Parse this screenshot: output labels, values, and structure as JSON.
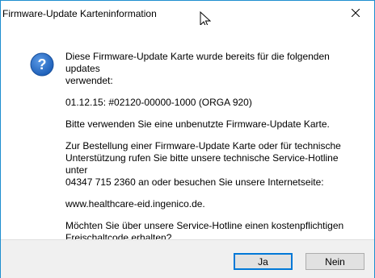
{
  "window": {
    "title": "Firmware-Update Karteninformation"
  },
  "icons": {
    "close": "close-icon",
    "question": "question-icon",
    "cursor": "mouse-cursor-icon"
  },
  "colors": {
    "window_border": "#1e8ecf",
    "icon_blue": "#1d5fb8",
    "footer_bg": "#f0f0f0",
    "button_bg": "#e1e1e1",
    "default_button_border": "#0078d7"
  },
  "message": {
    "paragraphs": [
      "Diese Firmware-Update Karte wurde bereits für die folgenden updates\nverwendet:",
      "01.12.15: #02120-00000-1000 (ORGA 920)",
      "Bitte verwenden Sie eine unbenutzte Firmware-Update Karte.",
      "Zur Bestellung einer Firmware-Update Karte oder für technische\nUnterstützung rufen Sie bitte unsere technische Service-Hotline unter\n04347 715 2360 an oder besuchen Sie unsere Internetseite:",
      "www.healthcare-eid.ingenico.de.",
      "Möchten Sie über unsere Service-Hotline einen kostenpflichtigen\nFreischaltcode erhalten?"
    ]
  },
  "buttons": {
    "yes": "Ja",
    "no": "Nein"
  }
}
